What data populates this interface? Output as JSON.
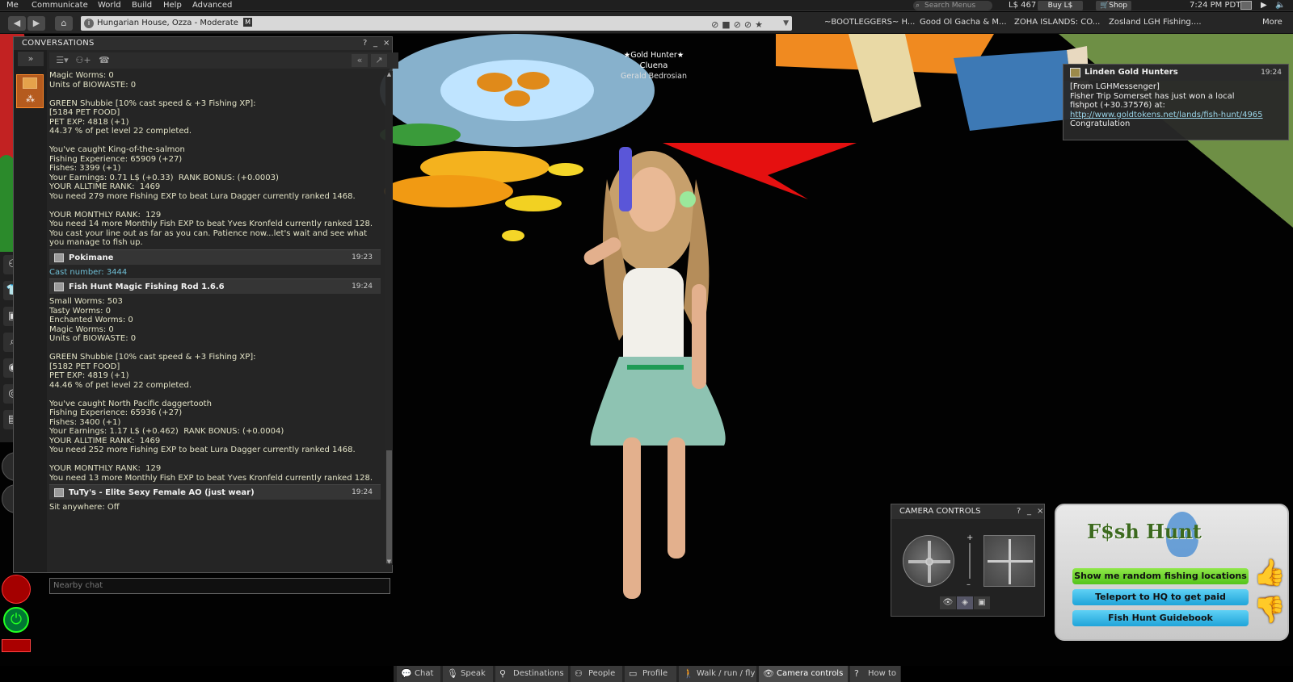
{
  "menubar": {
    "items": [
      "Me",
      "Communicate",
      "World",
      "Build",
      "Help",
      "Advanced"
    ],
    "search_placeholder": "Search Menus",
    "balance": "L$ 467",
    "buy_label": "Buy L$",
    "shop_label": "Shop",
    "clock": "7:24 PM PDT"
  },
  "navbar": {
    "location": "Hungarian House, Ozza - Moderate",
    "maturity_badge": "M",
    "favorites": [
      "~BOOTLEGGERS~ H...",
      "Good Ol Gacha & M...",
      "ZOHA ISLANDS: CO...",
      "Zosland LGH Fishing...."
    ],
    "more_label": "More"
  },
  "conversations": {
    "title": "CONVERSATIONS",
    "help": "?",
    "minimize": "_",
    "close": "×",
    "nearby_placeholder": "Nearby chat",
    "block1_lines": [
      "Magic Worms: 0",
      "Units of BIOWASTE: 0",
      "",
      "GREEN Shubbie [10% cast speed & +3 Fishing XP]:",
      "[5184 PET FOOD]",
      "PET EXP: 4818 (+1)",
      "44.37 % of pet level 22 completed.",
      "",
      "You've caught King-of-the-salmon",
      "Fishing Experience: 65909 (+27)",
      "Fishes: 3399 (+1)",
      "Your Earnings: 0.71 L$ (+0.33)  RANK BONUS: (+0.0003)",
      "YOUR ALLTIME RANK:  1469",
      "You need 279 more Fishing EXP to beat Lura Dagger currently ranked 1468.",
      "",
      "YOUR MONTHLY RANK:  129",
      "You need 14 more Monthly Fish EXP to beat Yves Kronfeld currently ranked 128.",
      "You cast your line out as far as you can. Patience now...let's wait and see what",
      "you manage to fish up."
    ],
    "msg_pokimane": {
      "name": "Pokimane",
      "time": "19:23",
      "text": "Cast number: 3444"
    },
    "msg_rod": {
      "name": "Fish Hunt Magic Fishing Rod 1.6.6",
      "time": "19:24"
    },
    "block2_lines": [
      "Small Worms: 503",
      "Tasty Worms: 0",
      "Enchanted Worms: 0",
      "Magic Worms: 0",
      "Units of BIOWASTE: 0",
      "",
      "GREEN Shubbie [10% cast speed & +3 Fishing XP]:",
      "[5182 PET FOOD]",
      "PET EXP: 4819 (+1)",
      "44.46 % of pet level 22 completed.",
      "",
      "You've caught North Pacific daggertooth",
      "Fishing Experience: 65936 (+27)",
      "Fishes: 3400 (+1)",
      "Your Earnings: 1.17 L$ (+0.462)  RANK BONUS: (+0.0004)",
      "YOUR ALLTIME RANK:  1469",
      "You need 252 more Fishing EXP to beat Lura Dagger currently ranked 1468.",
      "",
      "YOUR MONTHLY RANK:  129",
      "You need 13 more Monthly Fish EXP to beat Yves Kronfeld currently ranked 128."
    ],
    "msg_tuty": {
      "name": "TuTy's - Elite Sexy Female AO (just wear)",
      "time": "19:24",
      "text": "Sit anywhere: Off"
    }
  },
  "nametag": {
    "group": "★Gold Hunter★",
    "display_name": "Cluena",
    "username": "Gerald Bedrosian"
  },
  "toast": {
    "sender": "Linden Gold Hunters",
    "time": "19:24",
    "line1": "[From LGHMessenger]",
    "line2": "Fisher Trip Somerset has just won a local",
    "line3": "fishpot (+30.37576) at:",
    "link": "http://www.goldtokens.net/lands/fish-hunt/4965",
    "line4": "Congratulation"
  },
  "camera": {
    "title": "CAMERA CONTROLS",
    "help": "?",
    "minimize": "_",
    "close": "×"
  },
  "fishhunt": {
    "logo": "F$sh Hunt",
    "btn1": "Show me random fishing locations",
    "btn2": "Teleport to HQ to get paid",
    "btn3": "Fish Hunt Guidebook"
  },
  "bottombar": {
    "items": [
      "Chat",
      "Speak",
      "Destinations",
      "People",
      "Profile",
      "Walk / run / fly",
      "Camera controls",
      "How to"
    ]
  },
  "icons": [
    "back-arrow-icon",
    "forward-arrow-icon",
    "home-icon",
    "info-icon",
    "search-icon",
    "chat-icon",
    "camera-icon"
  ]
}
